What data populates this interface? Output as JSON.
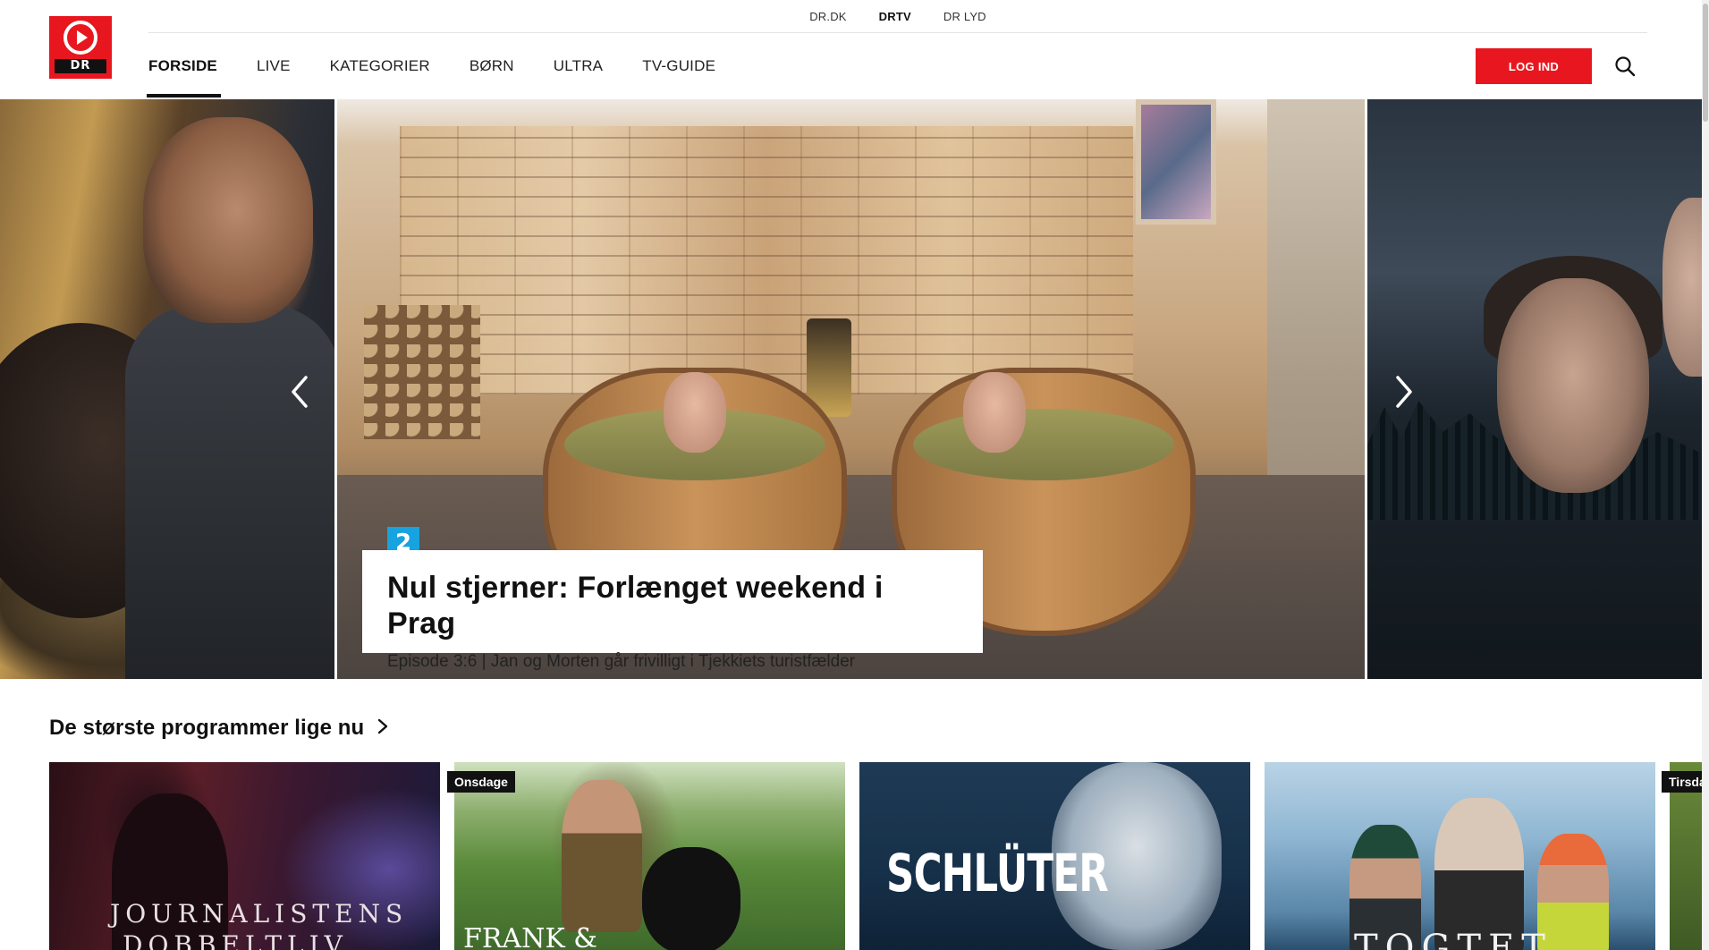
{
  "brand": {
    "logo_text": "DR",
    "accent": "#e8171f"
  },
  "top_nav": [
    {
      "label": "DR.DK",
      "active": false
    },
    {
      "label": "DRTV",
      "active": true
    },
    {
      "label": "DR LYD",
      "active": false
    }
  ],
  "main_nav": [
    {
      "label": "FORSIDE",
      "active": true
    },
    {
      "label": "LIVE",
      "active": false
    },
    {
      "label": "KATEGORIER",
      "active": false
    },
    {
      "label": "BØRN",
      "active": false
    },
    {
      "label": "ULTRA",
      "active": false
    },
    {
      "label": "TV-GUIDE",
      "active": false
    }
  ],
  "header": {
    "login_label": "LOG IND",
    "search_icon": "search-icon"
  },
  "hero": {
    "channel_badge": "2",
    "channel_color": "#17a2e0",
    "title": "Nul stjerner: Forlænget weekend i Prag",
    "subtitle": "Episode 3:6 | Jan og Morten går frivilligt i Tjekkiets turistfælder",
    "prev_icon": "chevron-left-icon",
    "next_icon": "chevron-right-icon"
  },
  "section": {
    "title": "De største programmer lige nu",
    "cards": [
      {
        "art_title_line1": "JOURNALISTENS",
        "art_title_line2": "DOBBELTLIV",
        "badge": ""
      },
      {
        "art_title": "FRANK &",
        "badge": "Onsdage"
      },
      {
        "art_title": "SCHLÜTER",
        "badge": ""
      },
      {
        "art_title": "TOGTET",
        "badge": ""
      },
      {
        "art_title": "",
        "badge": "Tirsda"
      }
    ]
  }
}
